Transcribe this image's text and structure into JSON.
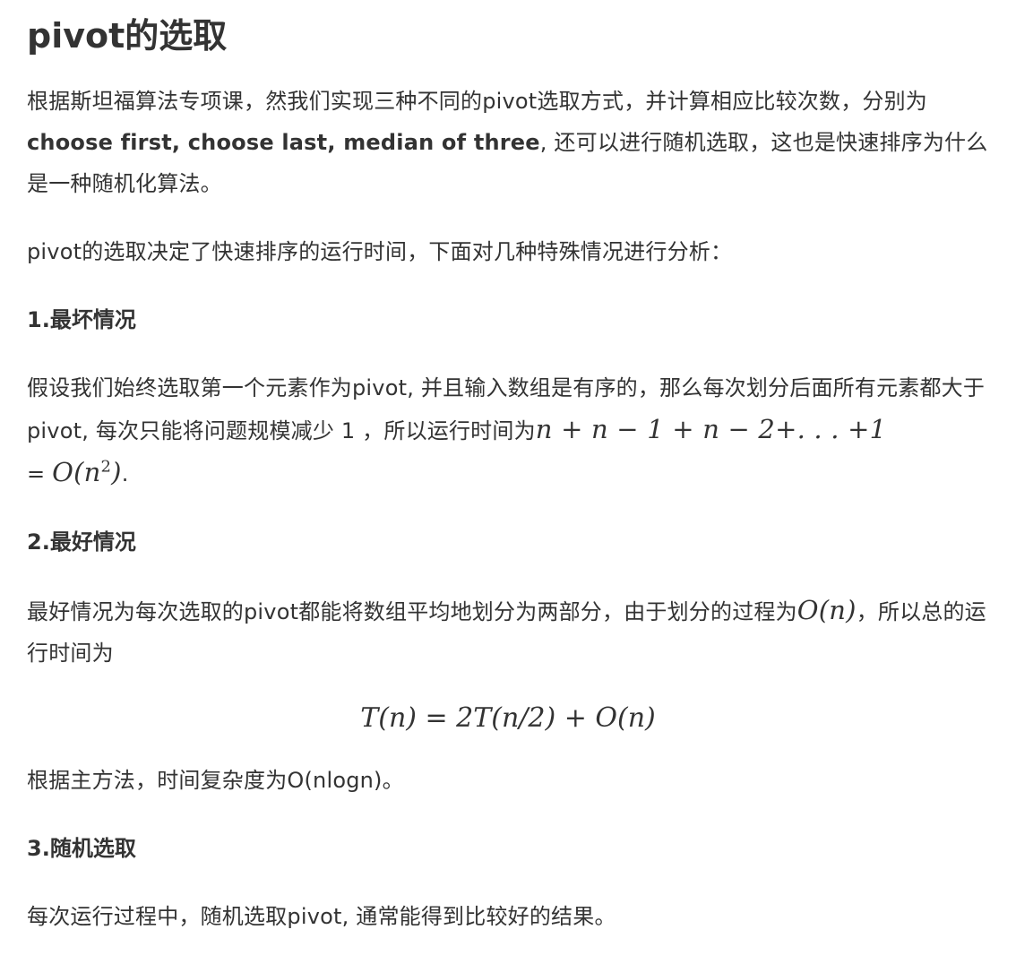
{
  "title": "pivot的选取",
  "intro": {
    "part1": "根据斯坦福算法专项课，然我们实现三种不同的pivot选取方式，并计算相应比较次数，分别为",
    "bold": "choose first, choose last, median of three",
    "part2": ", 还可以进行随机选取，这也是快速排序为什么是一种随机化算法。"
  },
  "overview": "pivot的选取决定了快速排序的运行时间，下面对几种特殊情况进行分析：",
  "worst": {
    "heading": "1.最坏情况",
    "text": "假设我们始终选取第一个元素作为pivot, 并且输入数组是有序的，那么每次划分后面所有元素都大于pivot, 每次只能将问题规模减少 1 ，所以运行时间为",
    "formula_sum": "n + n − 1 + n − 2+. . . +1",
    "equals": " = ",
    "formula_O": "O(n",
    "formula_exp": "2",
    "formula_close": ")",
    "end": "."
  },
  "best": {
    "heading": "2.最好情况",
    "text1": "最好情况为每次选取的pivot都能将数组平均地划分为两部分，由于划分的过程为",
    "formula_inline": "O(n)",
    "text2": "，所以总的运行时间为",
    "formula_display": "T(n) = 2T(n/2) + O(n)",
    "conclusion": "根据主方法，时间复杂度为O(nlogn)。"
  },
  "random": {
    "heading": "3.随机选取",
    "text": "每次运行过程中，随机选取pivot, 通常能得到比较好的结果。"
  }
}
